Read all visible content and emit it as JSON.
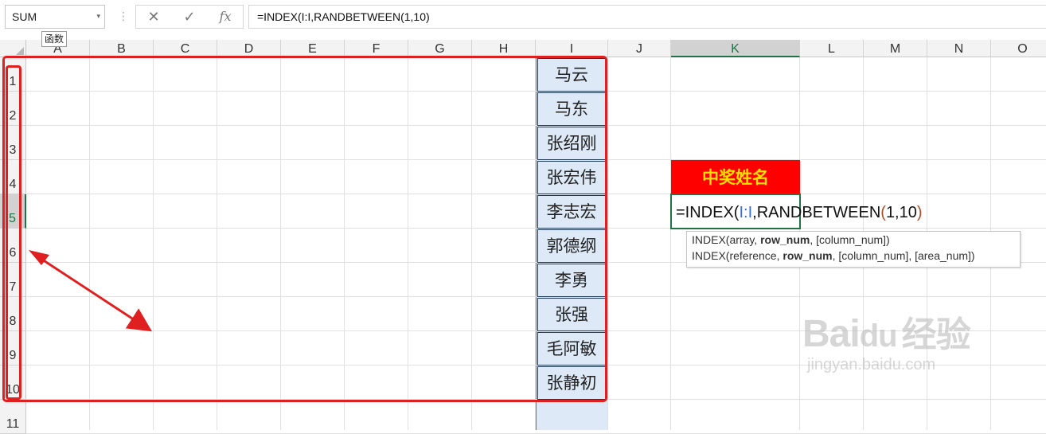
{
  "formula_bar": {
    "name_box_value": "SUM",
    "name_box_arrow": "▾",
    "separator": "⋮",
    "cancel_icon": "✕",
    "enter_icon": "✓",
    "fx_icon": "fx",
    "formula_text": "=INDEX(I:I,RANDBETWEEN(1,10)",
    "tooltip": "函数"
  },
  "columns": [
    "A",
    "B",
    "C",
    "D",
    "E",
    "F",
    "G",
    "H",
    "I",
    "J",
    "K",
    "L",
    "M",
    "N",
    "O"
  ],
  "selected_column": "K",
  "rows": [
    "1",
    "2",
    "3",
    "4",
    "5",
    "6",
    "7",
    "8",
    "9",
    "10",
    "11"
  ],
  "selected_row": "5",
  "names": [
    "马云",
    "马东",
    "张绍刚",
    "张宏伟",
    "李志宏",
    "郭德纲",
    "李勇",
    "张强",
    "毛阿敏",
    "张静初"
  ],
  "winner_header": "中奖姓名",
  "active_cell": {
    "part1": "=INDEX(",
    "ref": "I:I",
    "part2": ",RANDBETWEEN",
    "paren_open": "(",
    "args": "1,10",
    "paren_close": ")"
  },
  "fn_tooltip": {
    "line1_pre": "INDEX(array, ",
    "line1_bold": "row_num",
    "line1_post": ", [column_num])",
    "line2_pre": "INDEX(reference, ",
    "line2_bold": "row_num",
    "line2_post": ", [column_num], [area_num])"
  },
  "watermark": {
    "brand": "Bai",
    "paw": "du",
    "cn": "经验",
    "url": "jingyan.baidu.com"
  },
  "colors": {
    "accent_green": "#217346",
    "highlight_red": "#e02020",
    "winner_bg": "#ff0000",
    "winner_text": "#ffe000",
    "name_fill": "#dde9f6"
  }
}
